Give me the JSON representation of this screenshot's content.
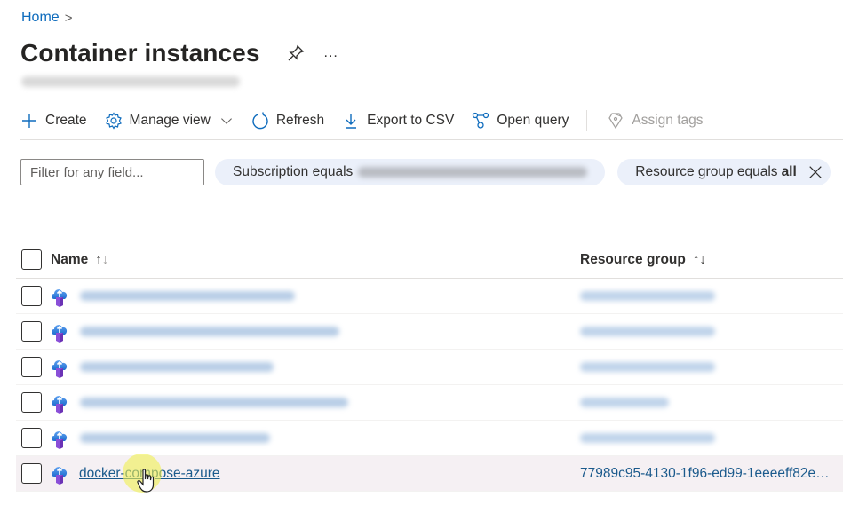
{
  "breadcrumb": {
    "home": "Home",
    "separator": ">"
  },
  "header": {
    "title": "Container instances",
    "pin_icon": "pin-icon",
    "more_label": "..."
  },
  "toolbar": {
    "create": "Create",
    "manage_view": "Manage view",
    "refresh": "Refresh",
    "export_csv": "Export to CSV",
    "open_query": "Open query",
    "assign_tags": "Assign tags"
  },
  "filters": {
    "search_placeholder": "Filter for any field...",
    "subscription_label": "Subscription equals",
    "resource_group_label": "Resource group equals",
    "resource_group_value": "all"
  },
  "table": {
    "columns": {
      "name": "Name",
      "resource_group": "Resource group",
      "sort_up": "↑",
      "sort_down": "↓"
    },
    "rows": [
      {
        "name": "",
        "resource_group": "",
        "blurred": true
      },
      {
        "name": "",
        "resource_group": "",
        "blurred": true
      },
      {
        "name": "",
        "resource_group": "",
        "blurred": true
      },
      {
        "name": "",
        "resource_group": "",
        "blurred": true
      },
      {
        "name": "",
        "resource_group": "",
        "blurred": true
      },
      {
        "name": "docker-compose-azure",
        "resource_group": "77989c95-4130-1f96-ed99-1eeeeff82e…",
        "blurred": false
      }
    ]
  },
  "colors": {
    "accent": "#0f6cbd",
    "link": "#1b5a8c",
    "pill_bg": "#ebf0fa",
    "hover_row": "#f5f0f3"
  }
}
